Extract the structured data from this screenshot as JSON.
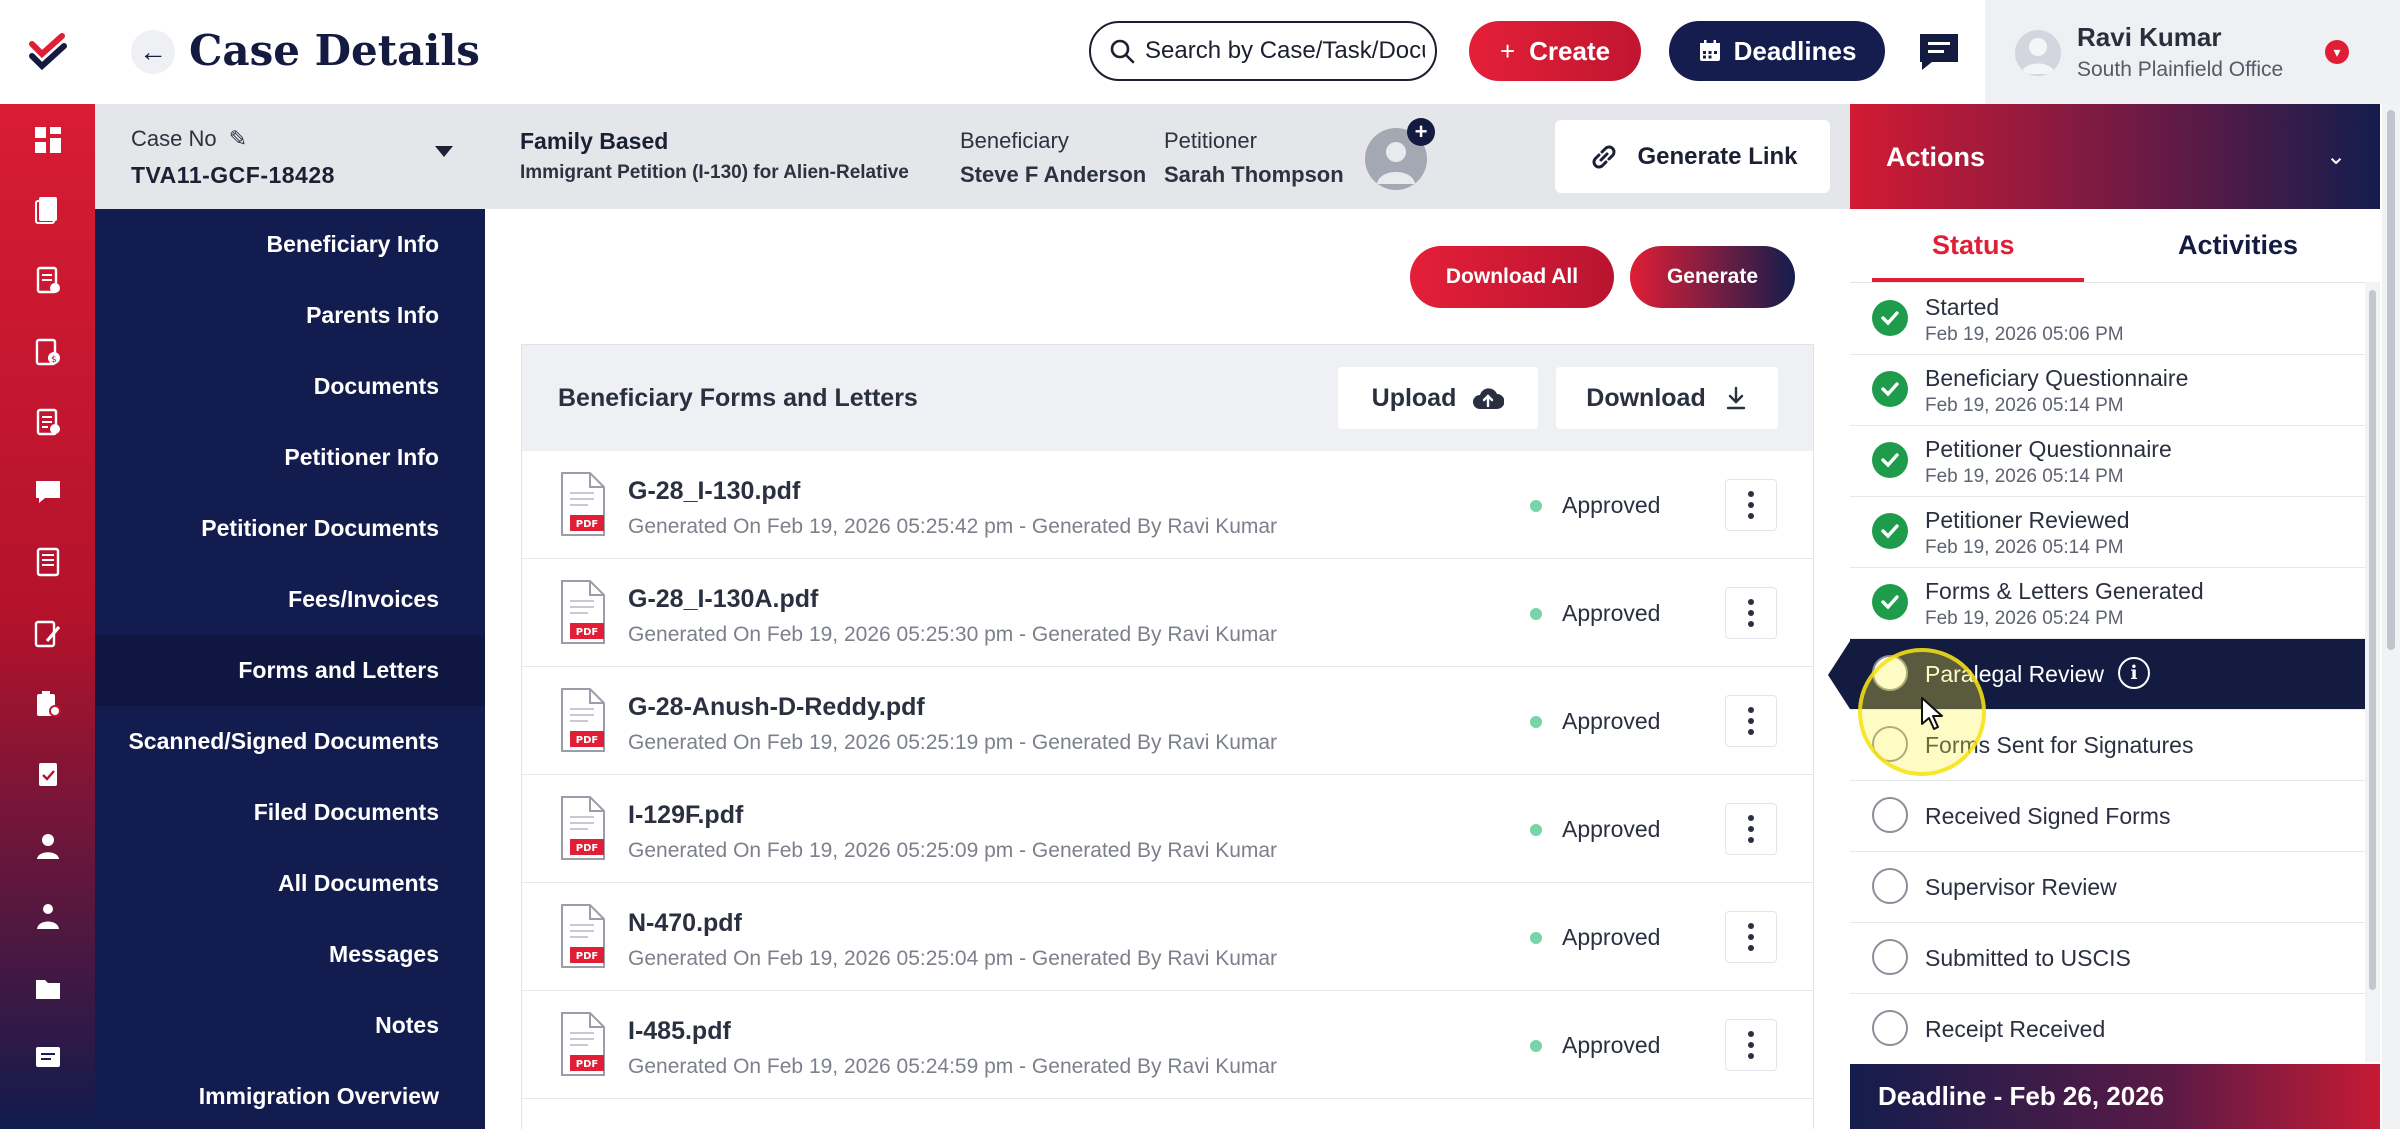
{
  "header": {
    "title": "Case Details",
    "search_placeholder": "Search by Case/Task/Docu",
    "create_label": "Create",
    "deadlines_label": "Deadlines",
    "user_name": "Ravi Kumar",
    "user_office": "South Plainfield Office"
  },
  "case": {
    "case_no_label": "Case No",
    "case_no": "TVA11-GCF-18428",
    "type": "Family Based",
    "type_sub": "Immigrant Petition (I-130) for Alien-Relative",
    "beneficiary_label": "Beneficiary",
    "beneficiary": "Steve F Anderson",
    "petitioner_label": "Petitioner",
    "petitioner": "Sarah Thompson",
    "generate_link_label": "Generate Link"
  },
  "nav": {
    "items": [
      "Beneficiary Info",
      "Parents Info",
      "Documents",
      "Petitioner Info",
      "Petitioner Documents",
      "Fees/Invoices",
      "Forms and Letters",
      "Scanned/Signed Documents",
      "Filed Documents",
      "All Documents",
      "Messages",
      "Notes",
      "Immigration Overview"
    ],
    "active": "Forms and Letters"
  },
  "main": {
    "download_all_label": "Download All",
    "generate_label": "Generate",
    "panel_title": "Beneficiary Forms and Letters",
    "upload_label": "Upload",
    "download_label": "Download",
    "files": [
      {
        "name": "G-28_I-130.pdf",
        "meta": "Generated On Feb 19, 2026 05:25:42 pm - Generated By Ravi Kumar",
        "status": "Approved"
      },
      {
        "name": "G-28_I-130A.pdf",
        "meta": "Generated On Feb 19, 2026 05:25:30 pm - Generated By Ravi Kumar",
        "status": "Approved"
      },
      {
        "name": "G-28-Anush-D-Reddy.pdf",
        "meta": "Generated On Feb 19, 2026 05:25:19 pm - Generated By Ravi Kumar",
        "status": "Approved"
      },
      {
        "name": "I-129F.pdf",
        "meta": "Generated On Feb 19, 2026 05:25:09 pm - Generated By Ravi Kumar",
        "status": "Approved"
      },
      {
        "name": "N-470.pdf",
        "meta": "Generated On Feb 19, 2026 05:25:04 pm - Generated By Ravi Kumar",
        "status": "Approved"
      },
      {
        "name": "I-485.pdf",
        "meta": "Generated On Feb 19, 2026 05:24:59 pm - Generated By Ravi Kumar",
        "status": "Approved"
      }
    ],
    "file_badge": "PDF"
  },
  "actions": {
    "title": "Actions",
    "tab_status": "Status",
    "tab_activities": "Activities",
    "steps": [
      {
        "title": "Started",
        "date": "Feb 19, 2026 05:06 PM",
        "state": "done"
      },
      {
        "title": "Beneficiary Questionnaire",
        "date": "Feb 19, 2026 05:14 PM",
        "state": "done"
      },
      {
        "title": "Petitioner Questionnaire",
        "date": "Feb 19, 2026 05:14 PM",
        "state": "done"
      },
      {
        "title": "Petitioner Reviewed",
        "date": "Feb 19, 2026 05:14 PM",
        "state": "done"
      },
      {
        "title": "Forms & Letters Generated",
        "date": "Feb 19, 2026 05:24 PM",
        "state": "done"
      },
      {
        "title": "Paralegal Review",
        "date": "",
        "state": "current"
      },
      {
        "title": "Forms Sent for Signatures",
        "date": "",
        "state": "pending"
      },
      {
        "title": "Received Signed Forms",
        "date": "",
        "state": "pending"
      },
      {
        "title": "Supervisor Review",
        "date": "",
        "state": "pending"
      },
      {
        "title": "Submitted to USCIS",
        "date": "",
        "state": "pending"
      },
      {
        "title": "Receipt Received",
        "date": "",
        "state": "pending"
      }
    ],
    "deadline": "Deadline - Feb 26, 2026"
  },
  "colors": {
    "brand_red": "#e01e36",
    "navy": "#141b40",
    "success_green": "#1e9c4b",
    "approved_dot": "#77d6a8"
  },
  "icons": {
    "rail": [
      "dashboard-icon",
      "cases-icon",
      "tasks-icon",
      "invoices-icon",
      "forms-icon",
      "messages-icon",
      "library-icon",
      "notes-icon",
      "reports-icon",
      "clipboard-icon",
      "contacts-icon",
      "users-icon",
      "folder-icon",
      "chat-icon"
    ]
  }
}
